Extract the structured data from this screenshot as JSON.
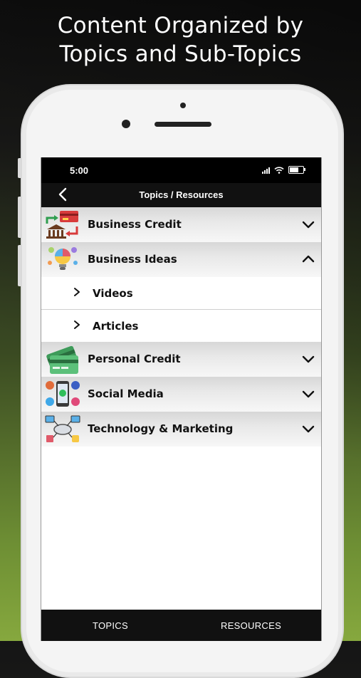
{
  "promo": {
    "line1": "Content Organized by",
    "line2": "Topics and Sub-Topics"
  },
  "status_bar": {
    "time": "5:00"
  },
  "nav": {
    "back_icon": "chevron-left-icon",
    "title": "Topics / Resources"
  },
  "topics": [
    {
      "label": "Business Credit",
      "icon": "bank-card-exchange-icon",
      "expanded": false
    },
    {
      "label": "Business Ideas",
      "icon": "lightbulb-gears-icon",
      "expanded": true,
      "subtopics": [
        {
          "label": "Videos"
        },
        {
          "label": "Articles"
        }
      ]
    },
    {
      "label": "Personal Credit",
      "icon": "credit-card-icon",
      "expanded": false
    },
    {
      "label": "Social Media",
      "icon": "social-network-icon",
      "expanded": false
    },
    {
      "label": "Technology & Marketing",
      "icon": "cloud-network-icon",
      "expanded": false
    }
  ],
  "tabs": {
    "topics": "TOPICS",
    "resources": "RESOURCES"
  },
  "colors": {
    "bar": "#111111",
    "row_gradient_top": "#d7d7d7",
    "green_accent": "#86a83e"
  }
}
